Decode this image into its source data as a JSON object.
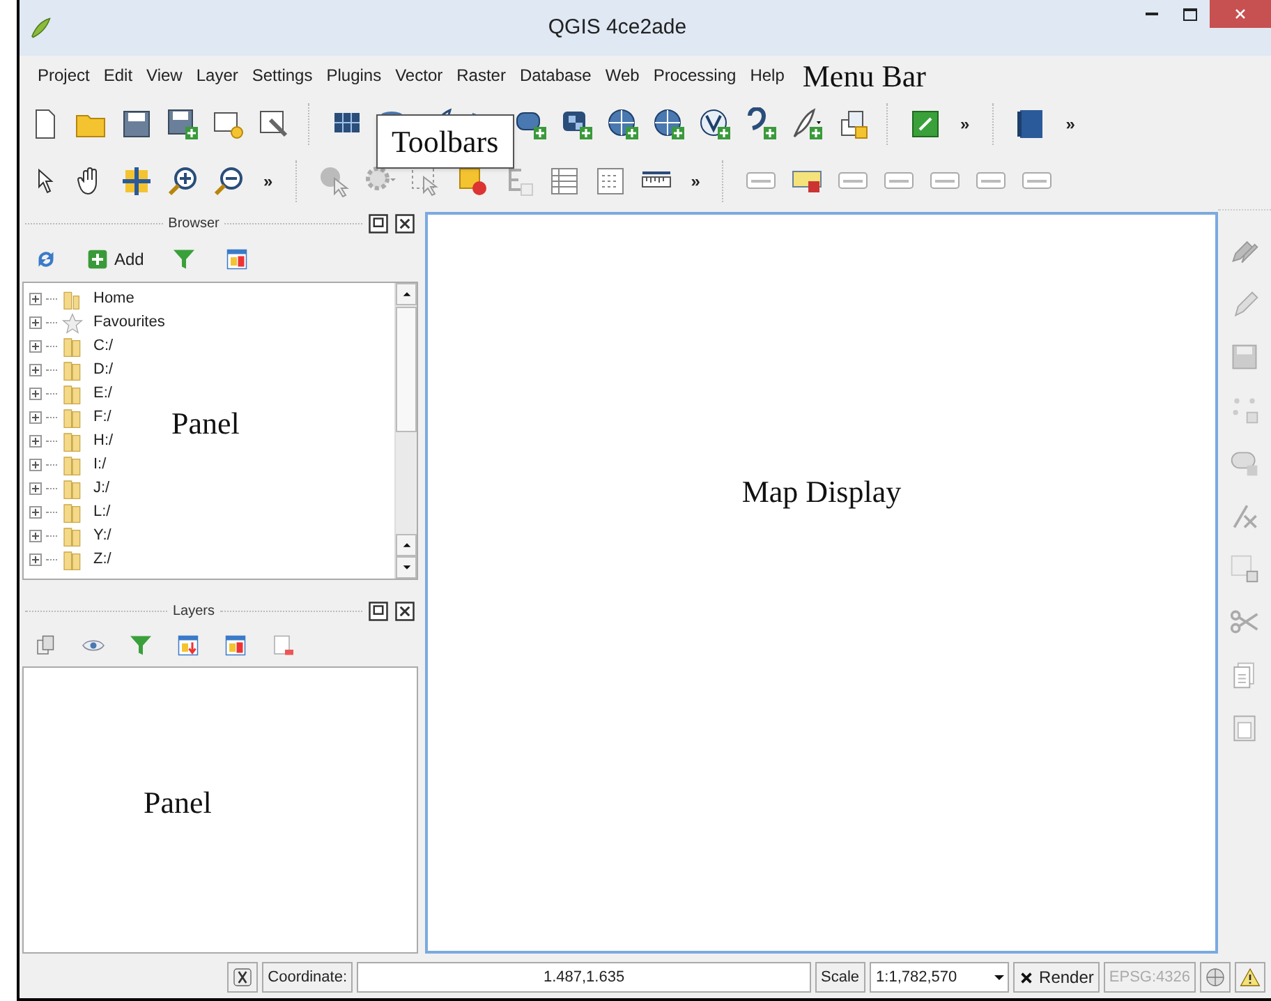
{
  "window": {
    "title": "QGIS 4ce2ade"
  },
  "menu_bar": {
    "items": [
      "Project",
      "Edit",
      "View",
      "Layer",
      "Settings",
      "Plugins",
      "Vector",
      "Raster",
      "Database",
      "Web",
      "Processing",
      "Help"
    ],
    "annotation": "Menu Bar"
  },
  "toolbars": {
    "annotation": "Toolbars",
    "rows": [
      {
        "overflow": [
          "»",
          "»"
        ]
      },
      {
        "overflow": [
          "»",
          "»"
        ]
      }
    ]
  },
  "browser_panel": {
    "title": "Browser",
    "add_button": "Add",
    "annotation": "Panel",
    "items": [
      {
        "label": "Home",
        "kind": "home",
        "expanded": false
      },
      {
        "label": "Favourites",
        "kind": "favourites",
        "expanded": false
      },
      {
        "label": "C:/",
        "kind": "drive",
        "expanded": false
      },
      {
        "label": "D:/",
        "kind": "drive",
        "expanded": false
      },
      {
        "label": "E:/",
        "kind": "drive",
        "expanded": false
      },
      {
        "label": "F:/",
        "kind": "drive",
        "expanded": false
      },
      {
        "label": "H:/",
        "kind": "drive",
        "expanded": false
      },
      {
        "label": "I:/",
        "kind": "drive",
        "expanded": false
      },
      {
        "label": "J:/",
        "kind": "drive",
        "expanded": false
      },
      {
        "label": "L:/",
        "kind": "drive",
        "expanded": false
      },
      {
        "label": "Y:/",
        "kind": "drive",
        "expanded": false
      },
      {
        "label": "Z:/",
        "kind": "drive",
        "expanded": false
      }
    ]
  },
  "layers_panel": {
    "title": "Layers",
    "annotation": "Panel"
  },
  "map_display": {
    "annotation": "Map Display"
  },
  "status_bar": {
    "coordinate_label": "Coordinate:",
    "coordinate": "1.487,1.635",
    "scale_label": "Scale",
    "scale": "1:1,782,570",
    "render": {
      "label": "Render",
      "checked": true
    },
    "crs": "EPSG:4326"
  }
}
